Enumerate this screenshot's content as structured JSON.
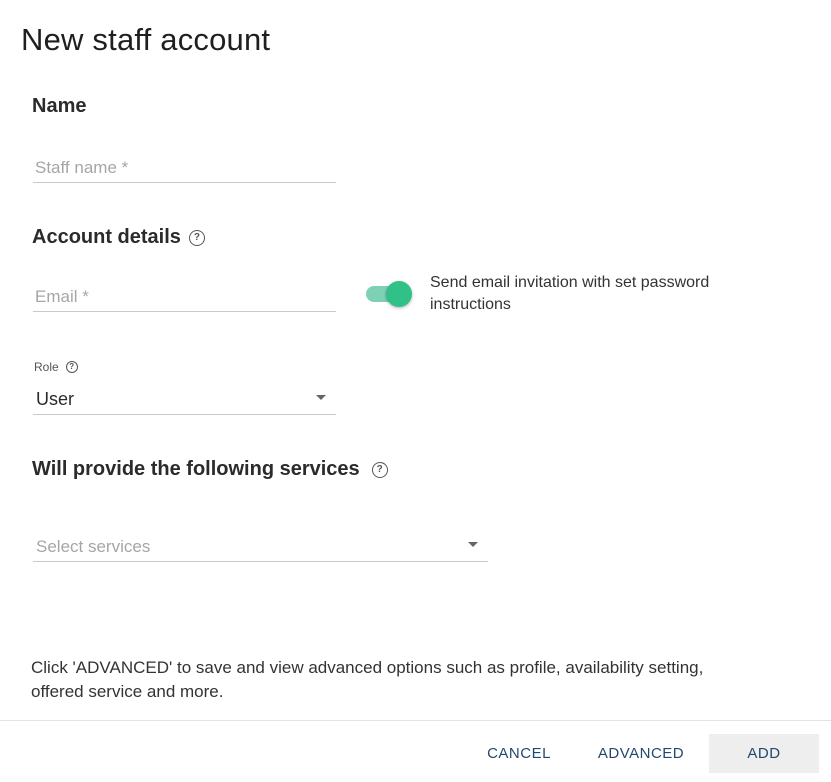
{
  "dialog": {
    "title": "New staff account"
  },
  "name_section": {
    "heading": "Name",
    "staff_name_placeholder": "Staff name *"
  },
  "account_section": {
    "heading": "Account details",
    "email_placeholder": "Email *",
    "invite_toggle": {
      "checked": true,
      "label": "Send email invitation with set password instructions"
    },
    "role": {
      "label": "Role",
      "value": "User"
    }
  },
  "services_section": {
    "heading": "Will provide the following services",
    "select_placeholder": "Select services"
  },
  "hint_text": "Click 'ADVANCED' to save and view advanced options such as profile, availability setting, offered service and more.",
  "footer": {
    "cancel_label": "CANCEL",
    "advanced_label": "ADVANCED",
    "add_label": "ADD"
  },
  "icons": {
    "help": "help-circle-icon",
    "dropdown": "caret-down-icon"
  },
  "colors": {
    "toggle_knob": "#2fc187",
    "toggle_track": "#7fd1b6",
    "button_text": "#23486e",
    "add_button_bg": "#eeeeee"
  }
}
